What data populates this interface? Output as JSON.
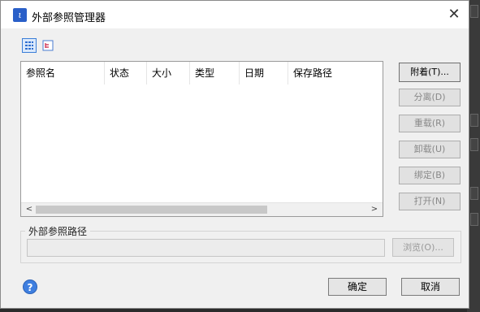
{
  "window": {
    "title": "外部参照管理器",
    "icon": "xref-app-icon",
    "close_label": "✕"
  },
  "view_toggles": [
    {
      "name": "list-view-icon",
      "active": true
    },
    {
      "name": "tree-view-icon",
      "active": false
    }
  ],
  "table": {
    "columns": [
      "参照名",
      "状态",
      "大小",
      "类型",
      "日期",
      "保存路径"
    ],
    "rows": [],
    "scroll_left_label": "<",
    "scroll_right_label": ">"
  },
  "side_buttons": {
    "attach": "附着(T)...",
    "detach": "分离(D)",
    "reload": "重载(R)",
    "unload": "卸载(U)",
    "bind": "绑定(B)",
    "open": "打开(N)"
  },
  "path_section": {
    "label": "外部参照路径",
    "value": "",
    "browse": "浏览(O)..."
  },
  "footer": {
    "help": "?",
    "ok": "确定",
    "cancel": "取消"
  },
  "colors": {
    "accent": "#3c7fd8",
    "dialog_bg": "#f0f0f0",
    "disabled_text": "#888888"
  }
}
